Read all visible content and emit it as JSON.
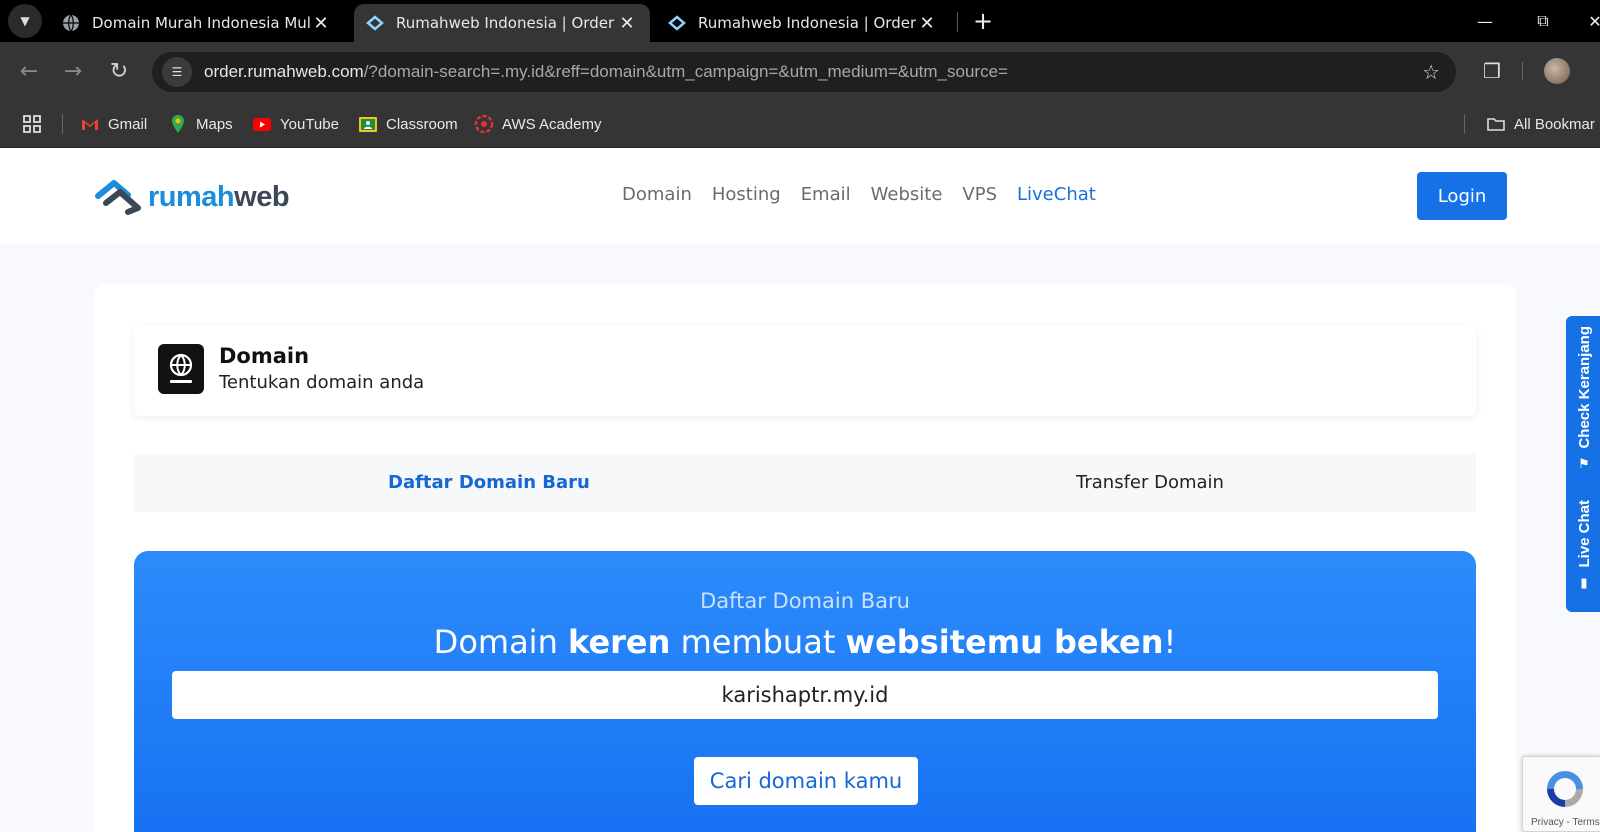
{
  "browser": {
    "tabs": [
      {
        "title": "Domain Murah Indonesia Mulai",
        "active": false
      },
      {
        "title": "Rumahweb Indonesia | Order",
        "active": true
      },
      {
        "title": "Rumahweb Indonesia | Order",
        "active": false
      }
    ],
    "close_glyph": "✕",
    "new_tab_glyph": "+",
    "url_host": "order.rumahweb.com",
    "url_rest": "/?domain-search=.my.id&reff=domain&utm_campaign=&utm_medium=&utm_source=",
    "bookmarks": [
      "Gmail",
      "Maps",
      "YouTube",
      "Classroom",
      "AWS Academy"
    ],
    "all_bookmarks": "All Bookmar"
  },
  "header": {
    "logo_part1": "rumah",
    "logo_part2": "web",
    "nav": [
      "Domain",
      "Hosting",
      "Email",
      "Website",
      "VPS",
      "LiveChat"
    ],
    "login": "Login"
  },
  "step": {
    "title": "Domain",
    "subtitle": "Tentukan domain anda"
  },
  "tabs": {
    "new": "Daftar Domain Baru",
    "transfer": "Transfer Domain"
  },
  "hero": {
    "eyebrow": "Daftar Domain Baru",
    "title_1": "Domain ",
    "title_bold_1": "keren",
    "title_2": " membuat ",
    "title_bold_2": "websitemu beken",
    "title_3": "!",
    "domain_value": "karishaptr.my.id",
    "search_button": "Cari domain kamu"
  },
  "side_widget": {
    "check_cart": "Check Keranjang",
    "live_chat": "Live Chat"
  },
  "recaptcha": {
    "links": "Privacy - Terms"
  },
  "colors": {
    "brand_blue": "#1771e6",
    "logo_blue": "#1a8ddc",
    "hero_gradient_top": "#2d8bfb",
    "hero_gradient_bottom": "#1670f2"
  }
}
